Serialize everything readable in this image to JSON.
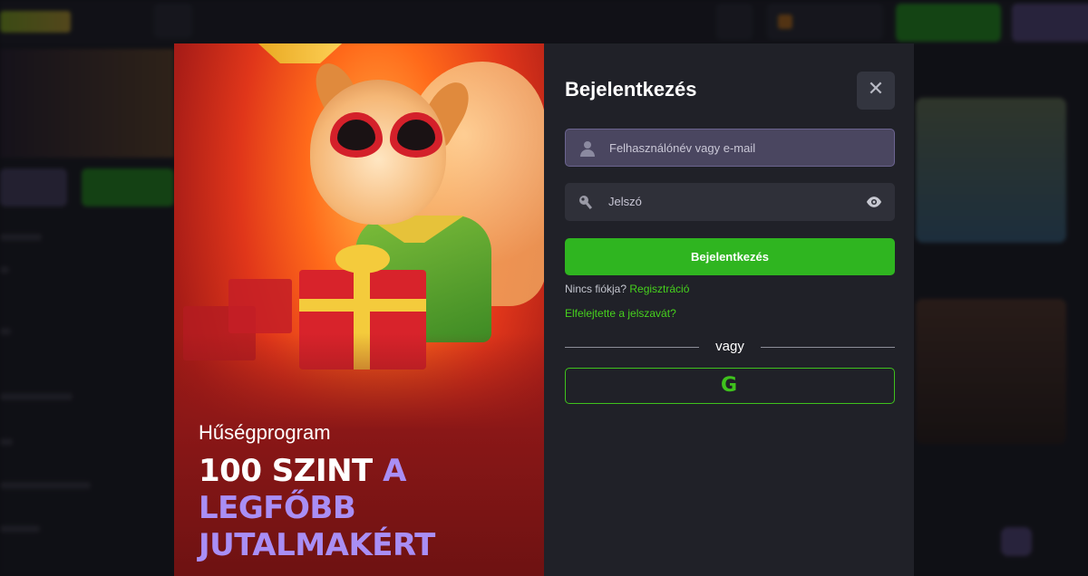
{
  "modal": {
    "promo": {
      "subtitle": "Hűségprogram",
      "title_white": "100 SZINT ",
      "title_purple_1": "A",
      "title_purple_2": "LEGFŐBB",
      "title_purple_3": "JUTALMAKÉRT"
    },
    "login": {
      "title": "Bejelentkezés",
      "close_glyph": "✕",
      "username_placeholder": "Felhasználónév vagy e-mail",
      "password_placeholder": "Jelszó",
      "submit_label": "Bejelentkezés",
      "no_account_text": "Nincs fiókja?",
      "register_link": "Regisztráció",
      "forgot_link": "Elfelejtette a jelszavát?",
      "divider_label": "vagy",
      "google_glyph": "G"
    }
  },
  "colors": {
    "accent_green": "#2fb520",
    "accent_purple": "#a98ef5",
    "modal_bg": "#202128",
    "input_bg": "#2f3039"
  },
  "icons": {
    "username": "user-icon",
    "password": "key-icon",
    "toggle_password": "eye-icon",
    "close": "close-icon",
    "google": "google-icon"
  }
}
